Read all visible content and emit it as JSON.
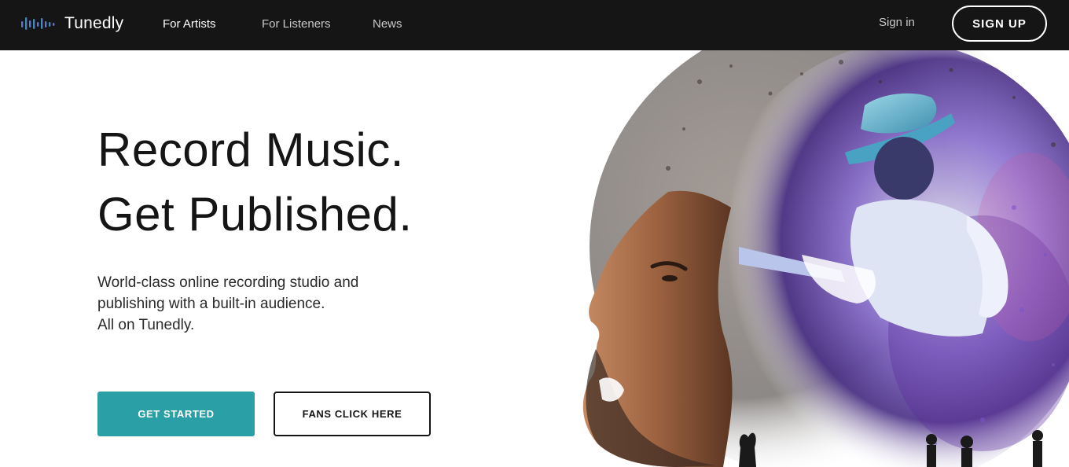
{
  "brand": {
    "name": "Tunedly",
    "logo_icon": "equalizer-bars-icon"
  },
  "nav": {
    "links": [
      {
        "label": "For Artists",
        "active": true
      },
      {
        "label": "For Listeners",
        "active": false
      },
      {
        "label": "News",
        "active": false
      }
    ],
    "sign_in": "Sign in",
    "sign_up": "SIGN UP"
  },
  "hero": {
    "headline_line1": "Record Music.",
    "headline_line2": "Get Published.",
    "sub_line1": "World-class online recording studio and",
    "sub_line2": "publishing with a built-in audience.",
    "sub_line3": "All on Tunedly.",
    "primary_cta": "GET STARTED",
    "secondary_cta": "FANS CLICK HERE",
    "image": "singer-profile-with-guitarist-collage"
  },
  "colors": {
    "nav_bg": "#151515",
    "accent_teal": "#2aa0a6",
    "text_dark": "#151515"
  }
}
